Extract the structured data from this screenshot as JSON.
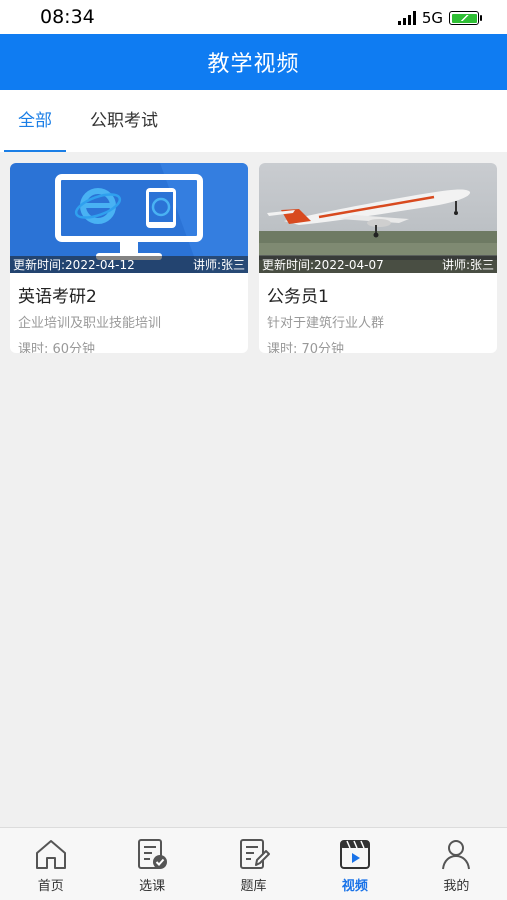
{
  "status": {
    "time": "08:34",
    "network": "5G"
  },
  "header": {
    "title": "教学视频"
  },
  "tabs": [
    {
      "label": "全部",
      "active": true
    },
    {
      "label": "公职考试",
      "active": false
    }
  ],
  "courses": [
    {
      "title": "英语考研2",
      "updated": "更新时间:2022-04-12",
      "teacher": "讲师:张三",
      "description": "企业培训及职业技能培训",
      "duration": "课时: 60分钟",
      "thumbnail": "monitor-ie-illustration"
    },
    {
      "title": "公务员1",
      "updated": "更新时间:2022-04-07",
      "teacher": "讲师:张三",
      "description": "针对于建筑行业人群",
      "duration": "课时: 70分钟",
      "thumbnail": "airplane-photo"
    }
  ],
  "nav": [
    {
      "label": "首页",
      "icon": "home-icon",
      "active": false
    },
    {
      "label": "选课",
      "icon": "course-select-icon",
      "active": false
    },
    {
      "label": "题库",
      "icon": "question-bank-icon",
      "active": false
    },
    {
      "label": "视频",
      "icon": "video-icon",
      "active": true
    },
    {
      "label": "我的",
      "icon": "profile-icon",
      "active": false
    }
  ],
  "colors": {
    "primary": "#0f7cf2",
    "active_tab": "#1a7ee6",
    "background": "#f0f0f0"
  }
}
